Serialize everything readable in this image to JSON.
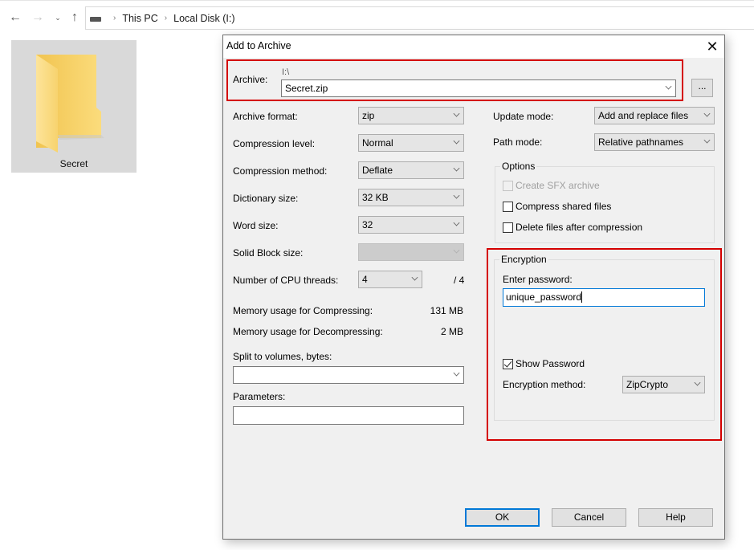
{
  "explorer": {
    "nav": {
      "back_icon": "arrow-left-icon",
      "forward_icon": "arrow-right-icon",
      "recent_icon": "chevron-down-icon",
      "up_icon": "arrow-up-icon"
    },
    "breadcrumb": [
      "This PC",
      "Local Disk (I:)"
    ],
    "folder": {
      "name": "Secret",
      "icon": "folder-icon"
    }
  },
  "dialog": {
    "title": "Add to Archive",
    "close_icon": "close-icon",
    "archive": {
      "label": "Archive:",
      "path": "I:\\",
      "filename": "Secret.zip",
      "browse_label": "..."
    },
    "left": {
      "archive_format": {
        "label": "Archive format:",
        "value": "zip"
      },
      "compression_level": {
        "label": "Compression level:",
        "value": "Normal"
      },
      "compression_method": {
        "label": "Compression method:",
        "value": "Deflate"
      },
      "dictionary_size": {
        "label": "Dictionary size:",
        "value": "32 KB"
      },
      "word_size": {
        "label": "Word size:",
        "value": "32"
      },
      "solid_block_size": {
        "label": "Solid Block size:",
        "value": ""
      },
      "cpu_threads": {
        "label": "Number of CPU threads:",
        "value": "4",
        "max": "/ 4"
      },
      "mem_compress": {
        "label": "Memory usage for Compressing:",
        "value": "131 MB"
      },
      "mem_decompress": {
        "label": "Memory usage for Decompressing:",
        "value": "2 MB"
      },
      "split_volumes": {
        "label": "Split to volumes, bytes:",
        "value": ""
      },
      "parameters": {
        "label": "Parameters:",
        "value": ""
      }
    },
    "right": {
      "update_mode": {
        "label": "Update mode:",
        "value": "Add and replace files"
      },
      "path_mode": {
        "label": "Path mode:",
        "value": "Relative pathnames"
      },
      "options": {
        "title": "Options",
        "create_sfx": {
          "label": "Create SFX archive",
          "checked": false,
          "enabled": false
        },
        "compress_shared": {
          "label": "Compress shared files",
          "checked": false
        },
        "delete_after": {
          "label": "Delete files after compression",
          "checked": false
        }
      },
      "encryption": {
        "title": "Encryption",
        "password_label": "Enter password:",
        "password_value": "unique_password",
        "show_password": {
          "label": "Show Password",
          "checked": true
        },
        "method_label": "Encryption method:",
        "method_value": "ZipCrypto"
      }
    },
    "buttons": {
      "ok": "OK",
      "cancel": "Cancel",
      "help": "Help"
    }
  },
  "annotations": {
    "highlight_color": "#d40000"
  }
}
